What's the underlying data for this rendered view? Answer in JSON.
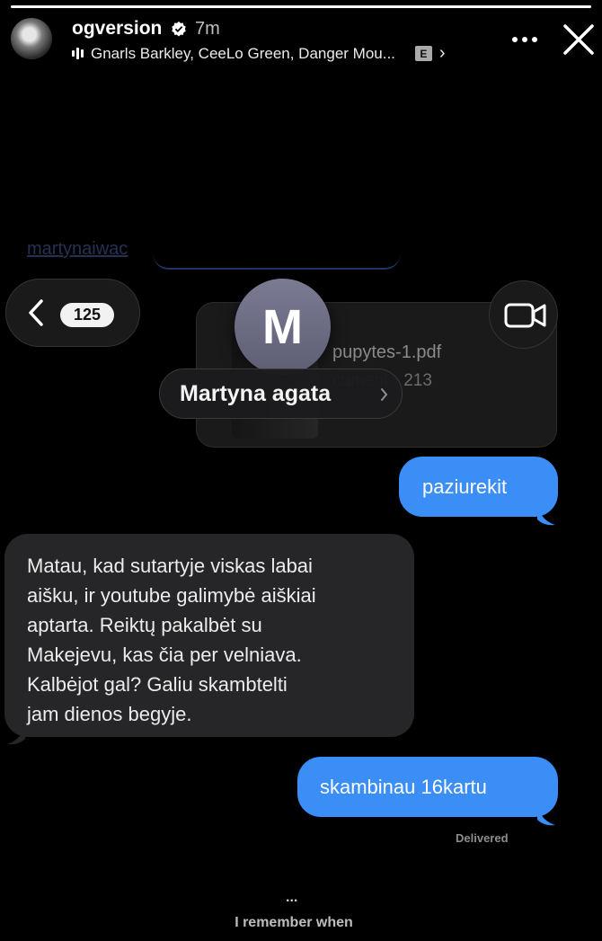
{
  "story": {
    "progress": 1.0,
    "username": "ogversion",
    "verified_icon": "verified-badge-icon",
    "time": "7m",
    "music": {
      "icon": "audio-bars-icon",
      "track": "Gnarls Barkley, CeeLo Green, Danger Mou...",
      "explicit": "E",
      "more_glyph": "›"
    }
  },
  "chat": {
    "ghost_link": "martynaiwac",
    "back_count": "125",
    "contact_initial": "M",
    "contact_name": "Martyna agata",
    "attachment": {
      "name": "pupytes-1.pdf",
      "meta": "cument · 213"
    },
    "messages": [
      {
        "side": "sent",
        "text": "paziurekit"
      },
      {
        "side": "received",
        "text": "Matau, kad sutartyje viskas labai\naišku, ir youtube galimybė aiškiai\naptarta. Reiktų pakalbėt su\nMakejevu, kas čia per velniava.\nKalbėjot gal? Galiu skambtelti\njam dienos begyje."
      },
      {
        "side": "sent",
        "text": "skambinau 16kartu"
      }
    ],
    "status": "Delivered"
  },
  "caption": {
    "dots": "...",
    "text": "I remember when"
  },
  "colors": {
    "sent_bubble": "#3a8ef6",
    "received_bubble": "#262628",
    "background": "#000000"
  }
}
